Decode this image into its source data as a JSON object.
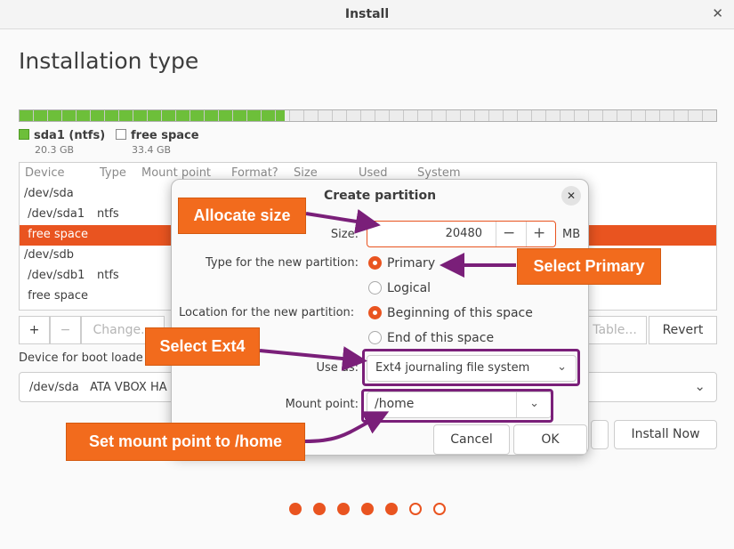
{
  "window": {
    "title": "Install"
  },
  "page": {
    "heading": "Installation type"
  },
  "partition_bar": {
    "used_fraction": 0.38,
    "used_color": "#6dbf3a"
  },
  "legend": [
    {
      "name": "sda1 (ntfs)",
      "size": "20.3 GB",
      "color": "#6dbf3a"
    },
    {
      "name": "free space",
      "size": "33.4 GB",
      "color": "#ffffff"
    }
  ],
  "table": {
    "columns": [
      "Device",
      "Type",
      "Mount point",
      "Format?",
      "Size",
      "Used",
      "System"
    ],
    "rows": [
      {
        "device": "/dev/sda",
        "type": ""
      },
      {
        "device": " /dev/sda1",
        "type": "ntfs"
      },
      {
        "device": " free space",
        "type": ""
      },
      {
        "device": "/dev/sdb",
        "type": ""
      },
      {
        "device": " /dev/sdb1",
        "type": "ntfs"
      },
      {
        "device": " free space",
        "type": ""
      }
    ],
    "selected_row": 2
  },
  "table_buttons": {
    "add": "+",
    "remove": "−",
    "change": "Change...",
    "new_table": "Table...",
    "revert": "Revert"
  },
  "boot_loader": {
    "label": "Device for boot loade",
    "value": "/dev/sda   ATA VBOX HA"
  },
  "buttons": {
    "install_now": "Install Now"
  },
  "progress_dots": {
    "total": 7,
    "filled": 5,
    "color": "#e95420"
  },
  "dialog": {
    "title": "Create partition",
    "size_label": "Size:",
    "size_value": "20480",
    "size_unit": "MB",
    "type_label": "Type for the new partition:",
    "type_options": [
      "Primary",
      "Logical"
    ],
    "location_label": "Location for the new partition:",
    "location_options": [
      "Beginning of this space",
      "End of this space"
    ],
    "use_as_label": "Use as:",
    "use_as_value": "Ext4 journaling file system",
    "mount_label": "Mount point:",
    "mount_value": "/home",
    "cancel": "Cancel",
    "ok": "OK"
  },
  "annotations": {
    "allocate": "Allocate size",
    "primary": "Select Primary",
    "ext4": "Select Ext4",
    "mount": "Set mount point to /home",
    "callout_color": "#f26b1d",
    "highlight_color": "#7a1f79"
  }
}
